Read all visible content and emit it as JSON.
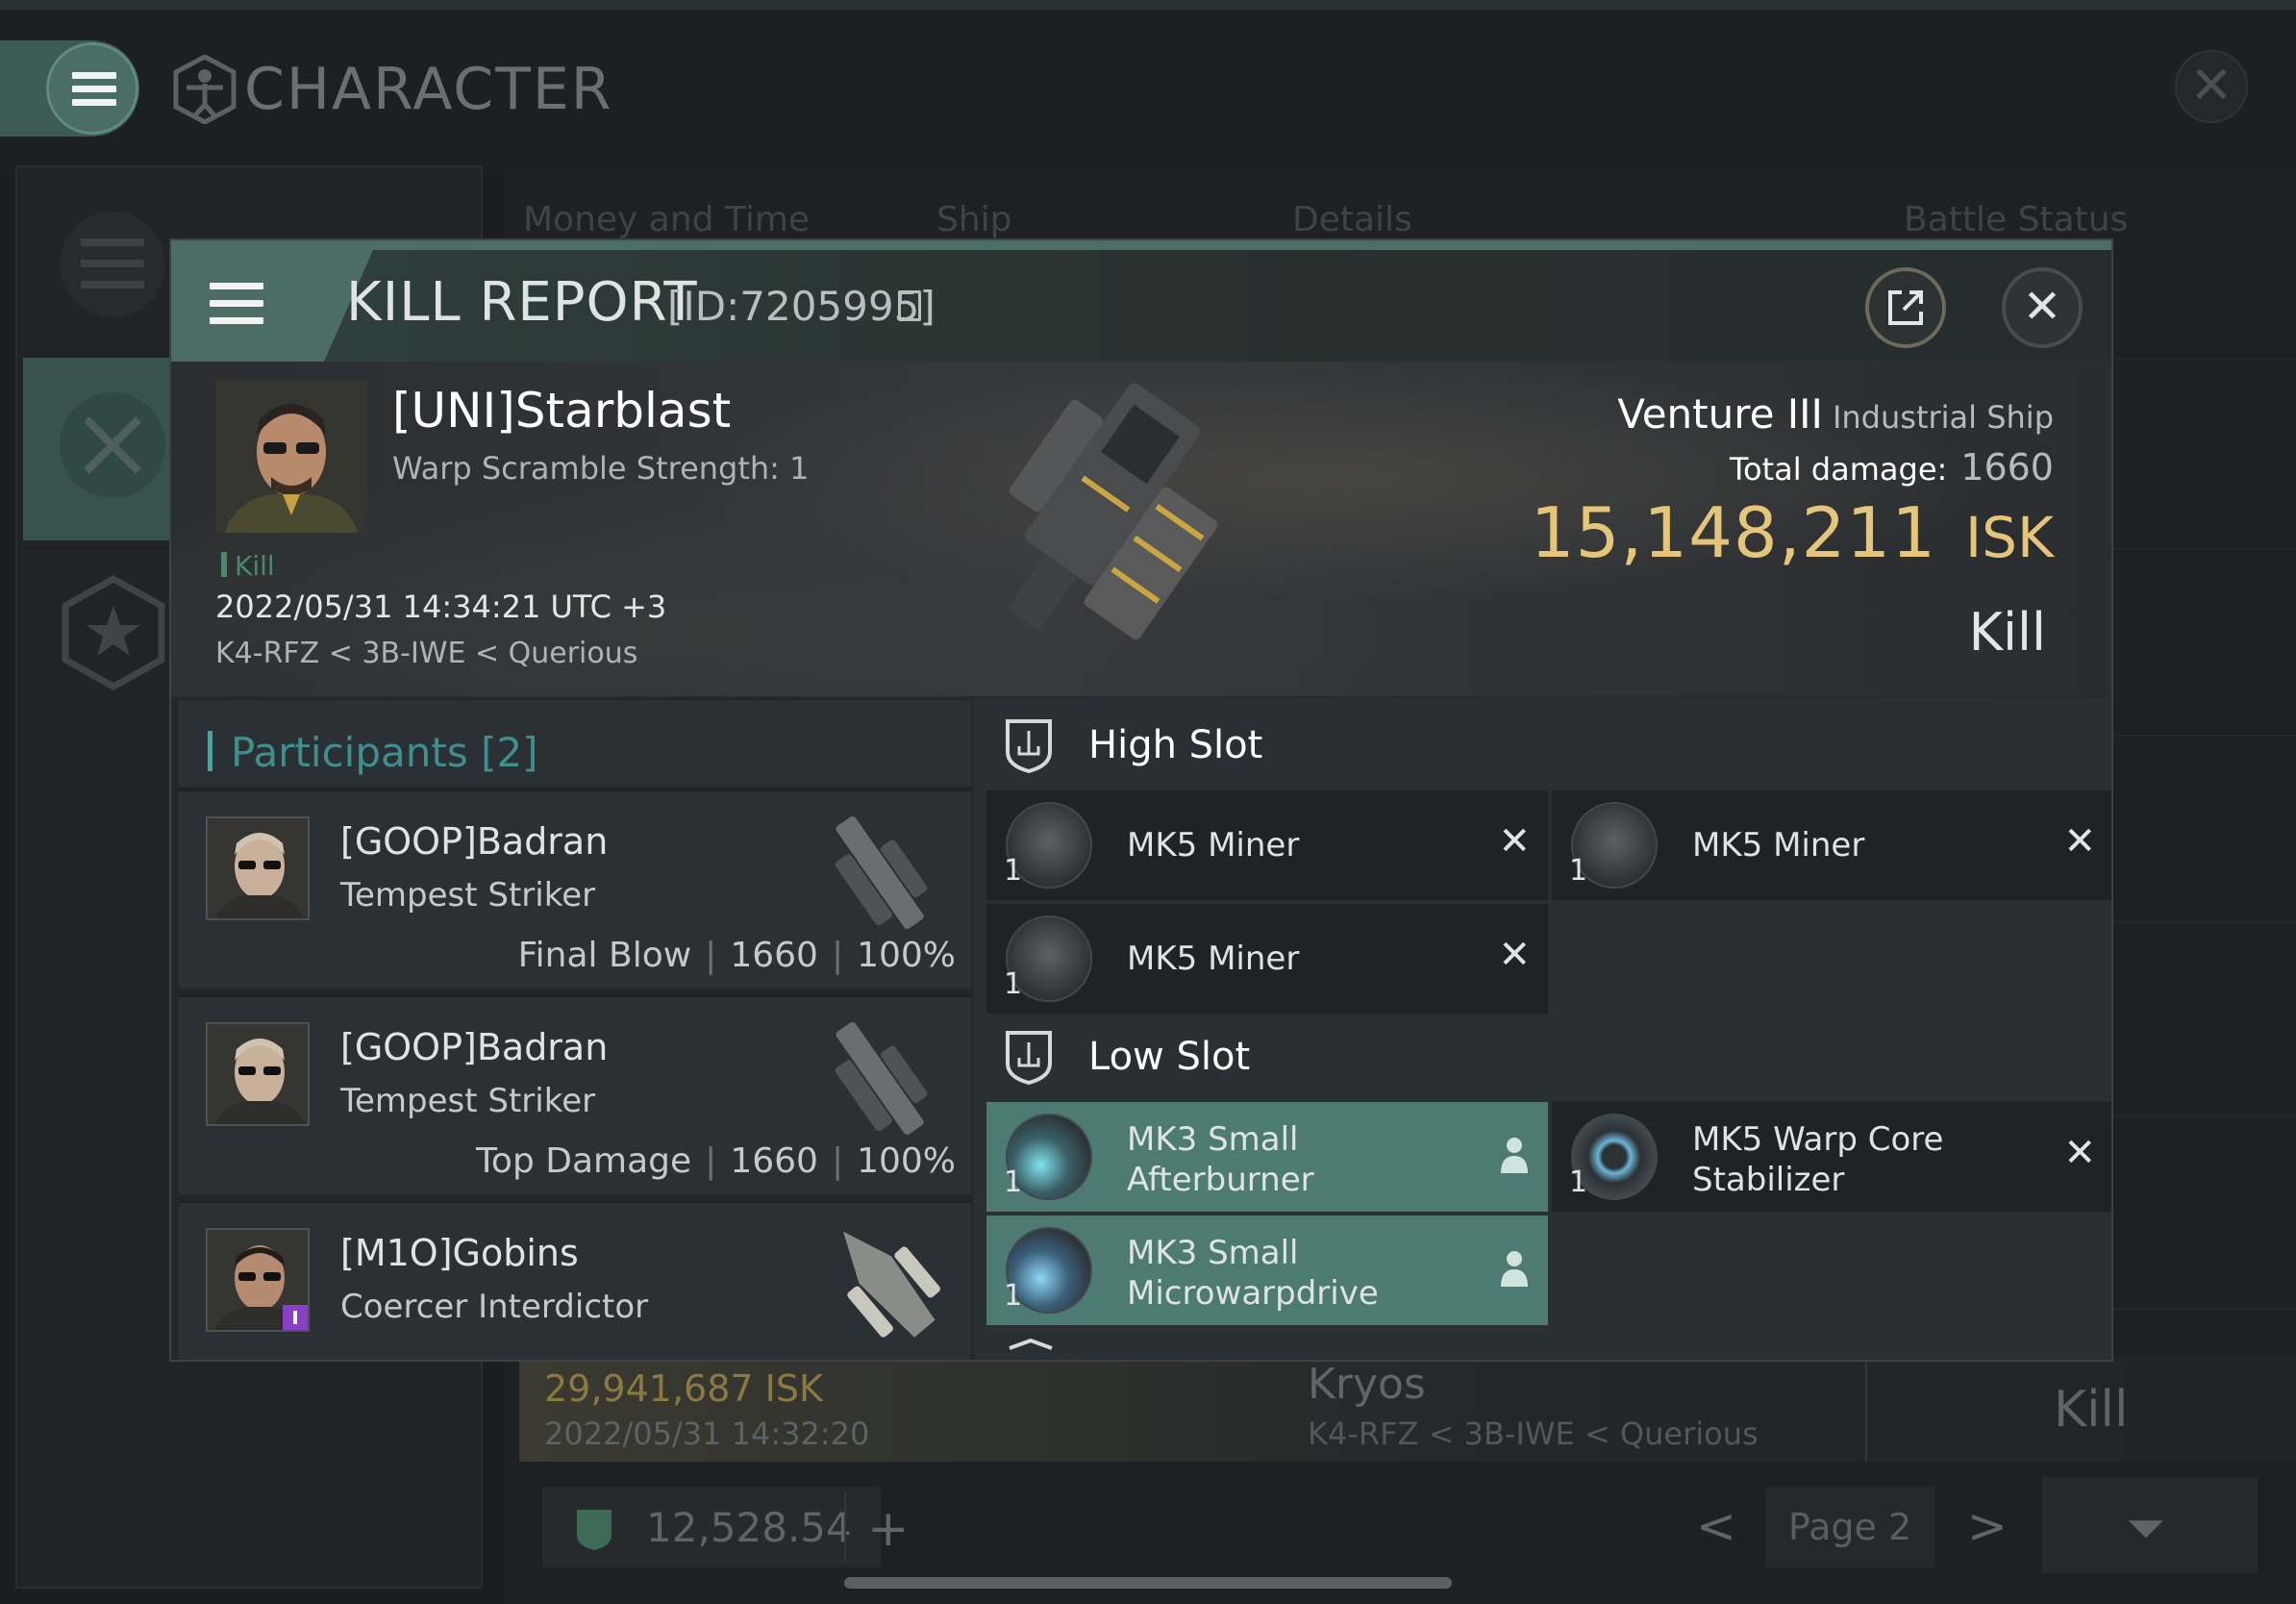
{
  "window": {
    "title": "CHARACTER"
  },
  "background_tabs": [
    "Money and Time",
    "Ship",
    "Details",
    "Battle Status"
  ],
  "background_row": {
    "isk": "29,941,687  ISK",
    "date": "2022/05/31  14:32:20",
    "ship": "Kryos",
    "location": "K4-RFZ < 3B-IWE < Querious",
    "result": "Kill"
  },
  "footer": {
    "wallet_value": "12,528.54",
    "plus": "+",
    "page_label": "Page 2",
    "prev": "<",
    "next": ">"
  },
  "modal": {
    "title": "KILL REPORT",
    "report_id": "[ID:7205995]",
    "victim": {
      "name": "[UNI]Starblast",
      "subtitle": "Warp Scramble Strength: 1",
      "flag": "Kill",
      "datetime": "2022/05/31 14:34:21 UTC +3",
      "location": "K4-RFZ < 3B-IWE < Querious"
    },
    "ship": {
      "name": "Venture III",
      "class": "Industrial Ship",
      "total_damage_label": "Total damage:",
      "total_damage": "1660",
      "isk_value": "15,148,211",
      "isk_unit": "ISK",
      "result": "Kill"
    },
    "participants": {
      "title": "Participants",
      "count": "[2]",
      "rows": [
        {
          "name": "[GOOP]Badran",
          "ship": "Tempest Striker",
          "role": "Final Blow",
          "damage": "1660",
          "percent": "100%"
        },
        {
          "name": "[GOOP]Badran",
          "ship": "Tempest Striker",
          "role": "Top Damage",
          "damage": "1660",
          "percent": "100%"
        },
        {
          "name": "[M1O]Gobins",
          "ship": "Coercer Interdictor"
        }
      ]
    },
    "fitting": {
      "high_slot": {
        "title": "High Slot",
        "modules": [
          {
            "line1": "MK5 Miner",
            "line2": "",
            "qty": "1",
            "status": "destroyed"
          },
          {
            "line1": "MK5 Miner",
            "line2": "",
            "qty": "1",
            "status": "destroyed"
          },
          {
            "line1": "MK5 Miner",
            "line2": "",
            "qty": "1",
            "status": "destroyed"
          }
        ]
      },
      "low_slot": {
        "title": "Low Slot",
        "modules": [
          {
            "line1": "MK3 Small",
            "line2": "Afterburner",
            "qty": "1",
            "status": "dropped"
          },
          {
            "line1": "MK5 Warp Core",
            "line2": "Stabilizer",
            "qty": "1",
            "status": "destroyed"
          },
          {
            "line1": "MK3 Small",
            "line2": "Microwarpdrive",
            "qty": "1",
            "status": "dropped"
          }
        ]
      }
    }
  },
  "colors": {
    "accent_teal": "#4b6d66",
    "isk_gold": "#e5c57a",
    "dropped_module": "#4d7a73",
    "participants_title": "#3f8f8e"
  },
  "icons": {
    "menu": "hamburger-icon",
    "character": "vitruvian-icon",
    "close": "close-icon",
    "external": "external-link-icon",
    "copy": "copy-icon",
    "slot": "slot-shield-icon",
    "pilot": "pilot-icon",
    "destroyed": "x-icon"
  }
}
